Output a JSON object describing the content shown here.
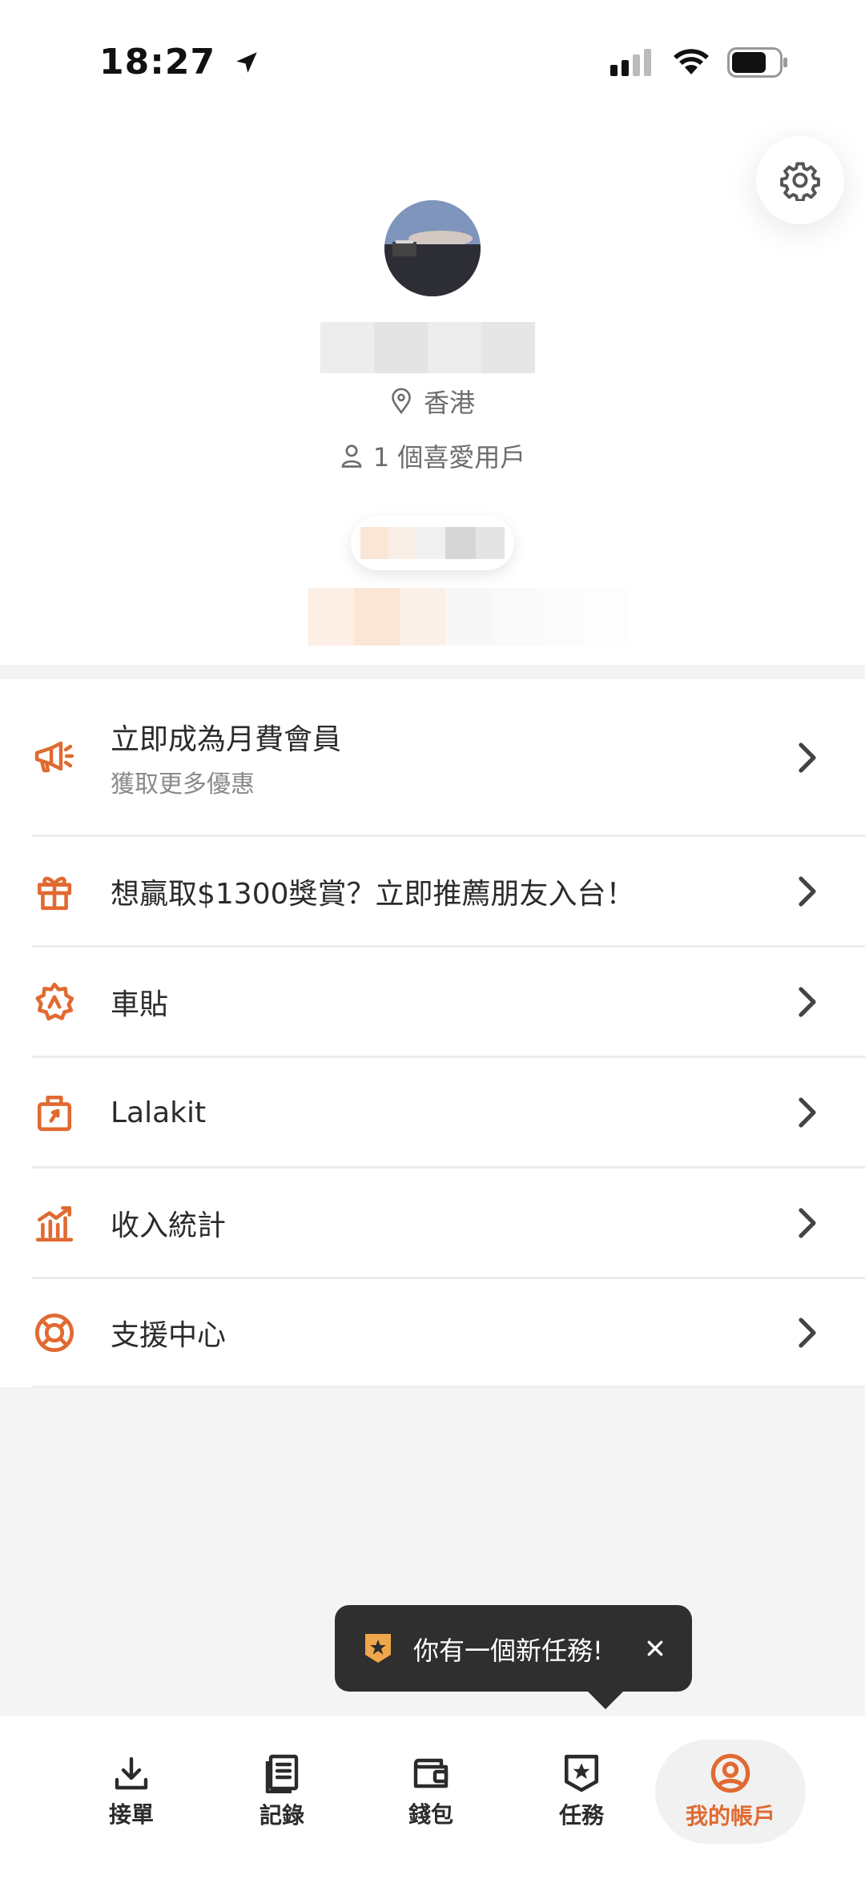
{
  "status_bar": {
    "time": "18:27"
  },
  "profile": {
    "location": "香港",
    "favorite_users": "1 個喜愛用戶"
  },
  "menu": {
    "items": [
      {
        "label": "立即成為月費會員",
        "sub": "獲取更多優惠",
        "icon": "megaphone-icon"
      },
      {
        "label": "想贏取$1300獎賞？立即推薦朋友入台！",
        "icon": "gift-icon"
      },
      {
        "label": "車貼",
        "icon": "sticker-badge-icon"
      },
      {
        "label": "Lalakit",
        "icon": "bag-icon"
      },
      {
        "label": "收入統計",
        "icon": "chart-icon"
      },
      {
        "label": "支援中心",
        "icon": "lifebuoy-icon"
      }
    ]
  },
  "toast": {
    "text": "你有一個新任務!",
    "close": "✕"
  },
  "bottom_nav": {
    "items": [
      {
        "label": "接單",
        "icon": "download-icon"
      },
      {
        "label": "記錄",
        "icon": "records-icon"
      },
      {
        "label": "錢包",
        "icon": "wallet-icon"
      },
      {
        "label": "任務",
        "icon": "task-star-icon"
      },
      {
        "label": "我的帳戶",
        "icon": "account-icon",
        "active": true
      }
    ]
  },
  "colors": {
    "accent": "#e06a31",
    "text": "#2b2b2b",
    "muted": "#8a8a8a",
    "toast_bg": "#2f2f2f"
  }
}
